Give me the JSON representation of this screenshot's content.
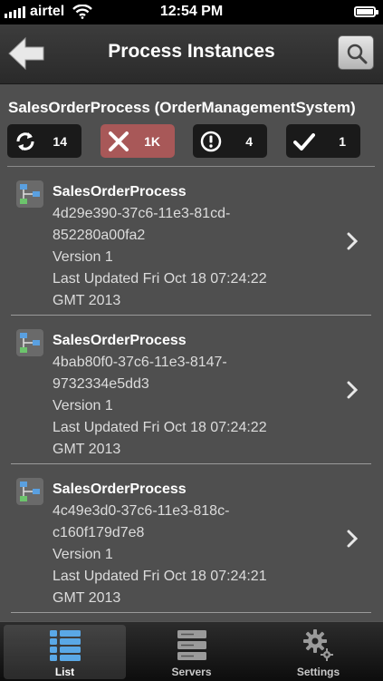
{
  "status_bar": {
    "carrier": "airtel",
    "time": "12:54 PM"
  },
  "nav": {
    "title": "Process Instances"
  },
  "process": {
    "title": "SalesOrderProcess (OrderManagementSystem)"
  },
  "stats": {
    "active": "14",
    "failed": "1K",
    "warnings": "4",
    "completed": "1"
  },
  "instances": [
    {
      "name": "SalesOrderProcess",
      "id_line1": "4d29e390-37c6-11e3-81cd-",
      "id_line2": "852280a00fa2",
      "version": "Version 1",
      "updated_line1": "Last Updated Fri Oct 18 07:24:22",
      "updated_line2": "GMT 2013"
    },
    {
      "name": "SalesOrderProcess",
      "id_line1": "4bab80f0-37c6-11e3-8147-",
      "id_line2": "9732334e5dd3",
      "version": "Version 1",
      "updated_line1": "Last Updated Fri Oct 18 07:24:22",
      "updated_line2": "GMT 2013"
    },
    {
      "name": "SalesOrderProcess",
      "id_line1": "4c49e3d0-37c6-11e3-818c-",
      "id_line2": "c160f179d7e8",
      "version": "Version 1",
      "updated_line1": "Last Updated Fri Oct 18 07:24:21",
      "updated_line2": "GMT 2013"
    }
  ],
  "tabs": [
    {
      "label": "List",
      "icon": "list-icon",
      "active": true
    },
    {
      "label": "Servers",
      "icon": "servers-icon",
      "active": false
    },
    {
      "label": "Settings",
      "icon": "gear-icon",
      "active": false
    }
  ],
  "colors": {
    "background": "#4f4f4f",
    "failed_badge": "#a85858",
    "badge": "#1a1a1a",
    "tab_active_icon": "#5aa8e6"
  }
}
